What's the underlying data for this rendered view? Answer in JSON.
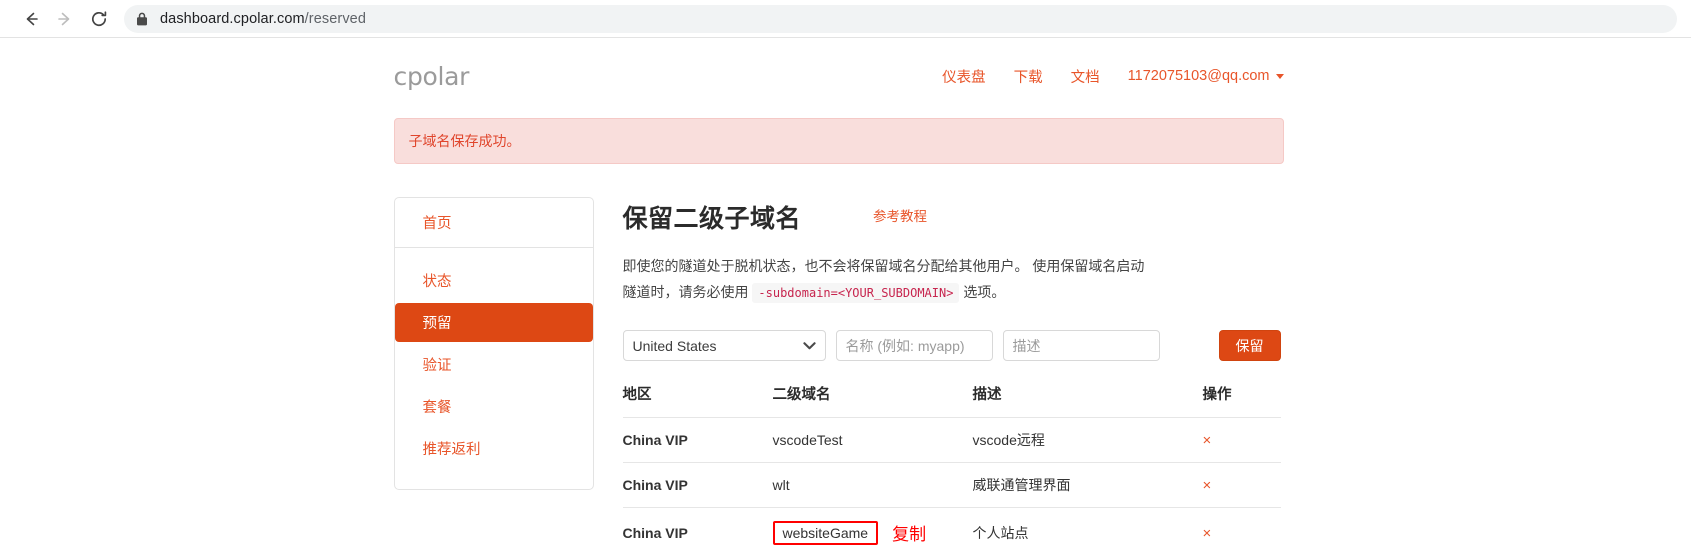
{
  "browser": {
    "back_icon": "arrow-left-icon",
    "forward_icon": "arrow-right-icon",
    "reload_icon": "reload-icon",
    "lock_icon": "lock-icon",
    "url_host": "dashboard.cpolar.com",
    "url_path": "/reserved"
  },
  "header": {
    "logo": "cpolar",
    "nav": [
      {
        "label": "仪表盘"
      },
      {
        "label": "下载"
      },
      {
        "label": "文档"
      }
    ],
    "user_email": "1172075103@qq.com",
    "user_caret_icon": "chevron-down-icon"
  },
  "alert": {
    "message": "子域名保存成功。",
    "bg_color": "#f9dedc",
    "text_color": "#e0452c"
  },
  "sidebar": {
    "header_label": "首页",
    "items": [
      {
        "label": "状态",
        "active": false
      },
      {
        "label": "预留",
        "active": true
      },
      {
        "label": "验证",
        "active": false
      },
      {
        "label": "套餐",
        "active": false
      },
      {
        "label": "推荐返利",
        "active": false
      }
    ],
    "active_bg_color": "#dd4814",
    "link_color": "#e8552a"
  },
  "main": {
    "title": "保留二级子域名",
    "tutorial_link": "参考教程",
    "description_part1": "即使您的隧道处于脱机状态，也不会将保留域名分配给其他用户。 使用保留域名启动隧道时，请务必使用",
    "description_code": "-subdomain=<YOUR_SUBDOMAIN>",
    "description_part2": "选项。",
    "form": {
      "region_selected": "United States",
      "region_options": [
        "United States"
      ],
      "name_placeholder": "名称 (例如: myapp)",
      "name_value": "",
      "desc_placeholder": "描述",
      "desc_value": "",
      "submit_label": "保留",
      "submit_color": "#dd4814"
    },
    "table": {
      "columns": [
        "地区",
        "二级域名",
        "描述",
        "操作"
      ],
      "rows": [
        {
          "region": "China VIP",
          "subdomain": "vscodeTest",
          "description": "vscode远程",
          "action": "×",
          "highlighted": false,
          "annotation": ""
        },
        {
          "region": "China VIP",
          "subdomain": "wlt",
          "description": "威联通管理界面",
          "action": "×",
          "highlighted": false,
          "annotation": ""
        },
        {
          "region": "China VIP",
          "subdomain": "websiteGame",
          "description": "个人站点",
          "action": "×",
          "highlighted": true,
          "annotation": "复制"
        }
      ]
    }
  },
  "annotations": {
    "highlight_color": "#ff0000"
  }
}
